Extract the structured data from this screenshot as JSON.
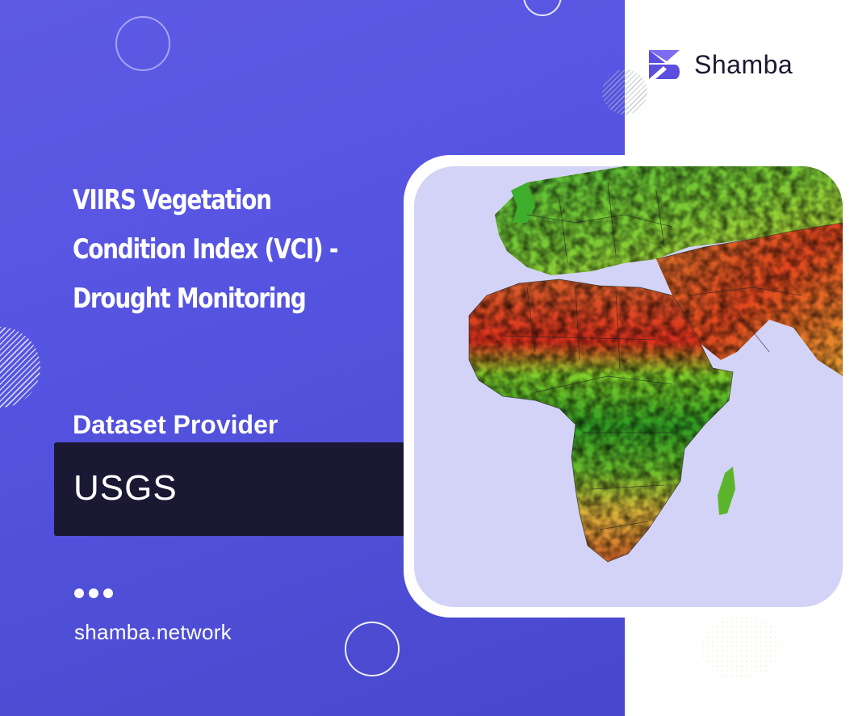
{
  "brand": {
    "name": "Shamba",
    "color": "#5b4fe0"
  },
  "title": {
    "line1": "VIIRS Vegetation",
    "line2": "Condition Index (VCI) -",
    "line3": "Drought Monitoring"
  },
  "provider": {
    "label": "Dataset Provider",
    "value": "USGS"
  },
  "footer": {
    "website": "shamba.network"
  },
  "map": {
    "subject": "vegetation-condition-map-africa-europe-middle-east"
  },
  "colors": {
    "panel": "#5654e0",
    "provider_box": "#1b1833",
    "ocean": "#d3d3f7"
  }
}
